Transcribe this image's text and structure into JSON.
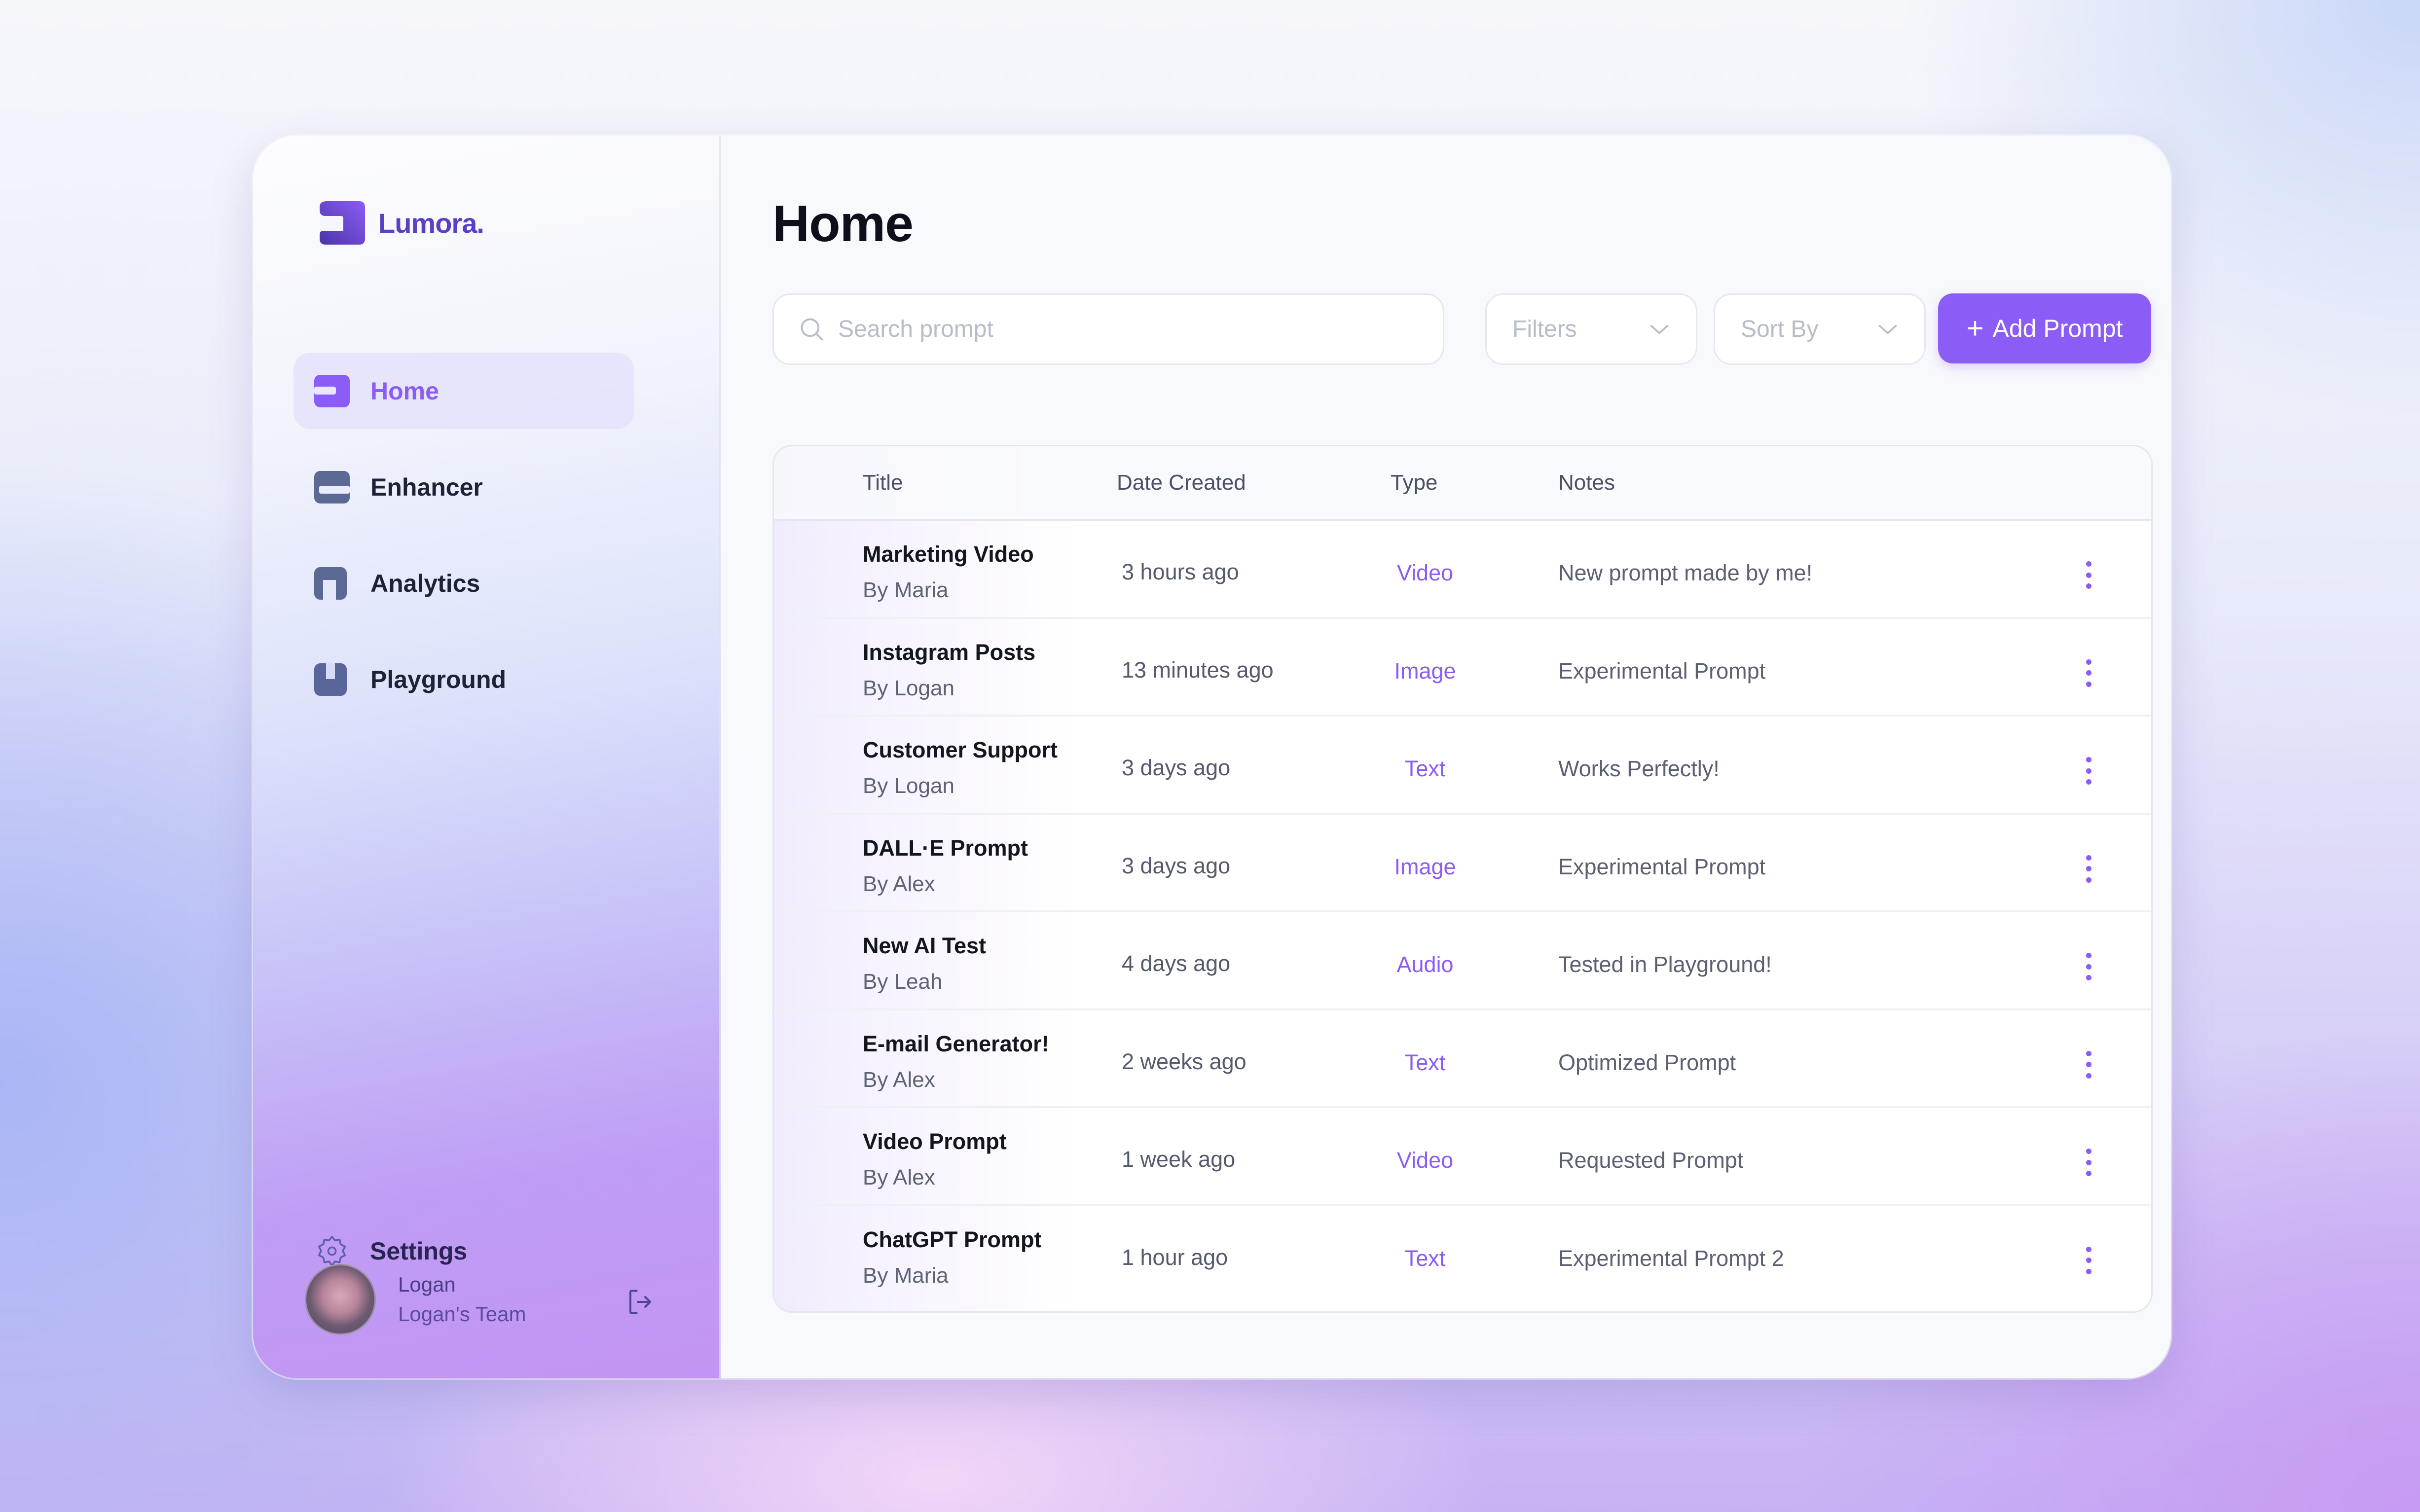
{
  "app": {
    "brand": "Lumora.",
    "colors": {
      "accent": "#8b5cf6",
      "brand_dark": "#5b3fc4",
      "text": "#14161f"
    }
  },
  "sidebar": {
    "items": [
      {
        "label": "Home",
        "icon": "home-icon",
        "active": true
      },
      {
        "label": "Enhancer",
        "icon": "enhancer-icon",
        "active": false
      },
      {
        "label": "Analytics",
        "icon": "analytics-icon",
        "active": false
      },
      {
        "label": "Playground",
        "icon": "playground-icon",
        "active": false
      }
    ],
    "settings_label": "Settings",
    "user": {
      "name": "Logan",
      "team": "Logan's Team"
    }
  },
  "main": {
    "title": "Home",
    "search": {
      "placeholder": "Search prompt",
      "value": ""
    },
    "filters": {
      "label": "Filters"
    },
    "sort": {
      "label": "Sort By"
    },
    "add_button": {
      "label": "Add Prompt"
    },
    "table": {
      "columns": [
        "Title",
        "Date Created",
        "Type",
        "Notes"
      ],
      "rows": [
        {
          "title": "Marketing Video",
          "author": "By Maria",
          "date": "3 hours ago",
          "type": "Video",
          "notes": "New prompt made by me!"
        },
        {
          "title": "Instagram Posts",
          "author": "By Logan",
          "date": "13 minutes ago",
          "type": "Image",
          "notes": "Experimental Prompt"
        },
        {
          "title": "Customer Support",
          "author": "By Logan",
          "date": "3 days ago",
          "type": "Text",
          "notes": "Works Perfectly!"
        },
        {
          "title": "DALL·E Prompt",
          "author": "By Alex",
          "date": "3 days ago",
          "type": "Image",
          "notes": "Experimental Prompt"
        },
        {
          "title": "New AI Test",
          "author": "By Leah",
          "date": "4 days ago",
          "type": "Audio",
          "notes": "Tested in Playground!"
        },
        {
          "title": "E-mail Generator!",
          "author": "By Alex",
          "date": "2 weeks ago",
          "type": "Text",
          "notes": "Optimized Prompt"
        },
        {
          "title": "Video Prompt",
          "author": "By Alex",
          "date": "1 week ago",
          "type": "Video",
          "notes": "Requested Prompt"
        },
        {
          "title": "ChatGPT Prompt",
          "author": "By Maria",
          "date": "1 hour ago",
          "type": "Text",
          "notes": "Experimental Prompt 2"
        }
      ]
    }
  }
}
